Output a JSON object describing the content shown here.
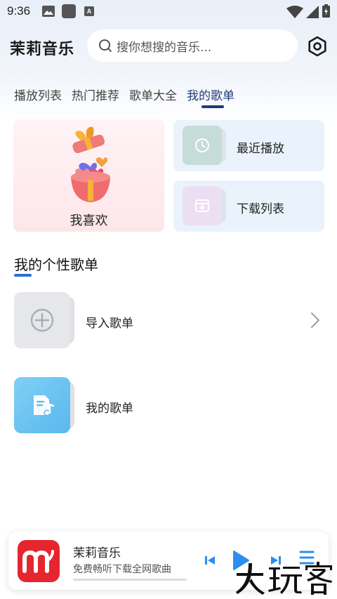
{
  "status": {
    "time": "9:36",
    "icon_a": "A"
  },
  "header": {
    "app_title": "茉莉音乐",
    "search_placeholder": "搜你想搜的音乐..."
  },
  "tabs": [
    {
      "label": "播放列表",
      "active": false
    },
    {
      "label": "热门推荐",
      "active": false
    },
    {
      "label": "歌单大全",
      "active": false
    },
    {
      "label": "我的歌单",
      "active": true
    }
  ],
  "cards": {
    "favorites": {
      "label": "我喜欢"
    },
    "recent": {
      "label": "最近播放"
    },
    "downloads": {
      "label": "下载列表"
    }
  },
  "section": {
    "title": "我的个性歌单"
  },
  "playlists": [
    {
      "label": "导入歌单"
    },
    {
      "label": "我的歌单"
    }
  ],
  "player": {
    "title": "茉莉音乐",
    "subtitle": "免费畅听下载全网歌曲",
    "progress": 0
  },
  "colors": {
    "accent": "#1d3b78",
    "section_accent": "#2b6fd6",
    "player_blue": "#2b8ef0",
    "logo_red": "#e5262f"
  },
  "icons": [
    "image-icon",
    "app-square-icon",
    "a-icon",
    "wifi-icon",
    "signal-icon",
    "battery-icon",
    "search-icon",
    "settings-icon",
    "clock-icon",
    "download-icon",
    "plus-circle-icon",
    "music-note-icon",
    "chevron-right-icon",
    "skip-previous-icon",
    "play-icon",
    "skip-next-icon",
    "playlist-icon"
  ]
}
